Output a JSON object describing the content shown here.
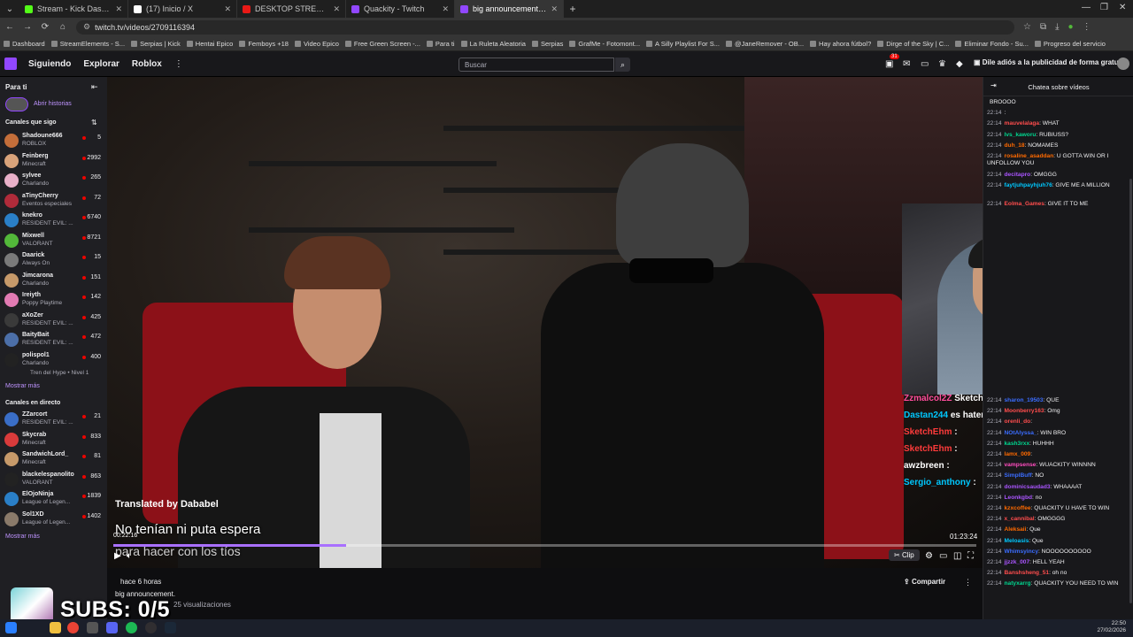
{
  "browser": {
    "tabs": [
      {
        "label": "Stream - Kick Dashboard",
        "color": "#53fc18",
        "active": false
      },
      {
        "label": "(17) Inicio / X",
        "color": "#ffffff",
        "active": false
      },
      {
        "label": "DESKTOP STREAM FT. MR.BEAST",
        "color": "#e91916",
        "active": false
      },
      {
        "label": "Quackity - Twitch",
        "color": "#9147ff",
        "active": false
      },
      {
        "label": "big announcement. - Twitch",
        "color": "#9147ff",
        "active": true
      }
    ],
    "url": "twitch.tv/videos/2709116394",
    "bookmarks": [
      "Dashboard",
      "StreamElements - S...",
      "Serpias | Kick",
      "Hentai Epico",
      "Femboys +18",
      "Video Epico",
      "Free Green Screen -...",
      "Para ti",
      "La Ruleta Aleatoria",
      "Serpias",
      "GrafMe - Fotomont...",
      "A Silly Playlist For S...",
      "@JaneRemover - OB...",
      "Hay ahora fútbol?",
      "Dirge of the Sky | C...",
      "Eliminar Fondo - Su...",
      "Progreso del servicio"
    ]
  },
  "topnav": {
    "links": [
      "Siguiendo",
      "Explorar",
      "Roblox"
    ],
    "search_placeholder": "Buscar",
    "notif_count": "31",
    "ad_label": "Dile adiós a la publicidad de forma gratuita"
  },
  "sidebar": {
    "para_ti": "Para ti",
    "abrir_historias": "Abrir historias",
    "followed_header": "Canales que sigo",
    "followed": [
      {
        "name": "Shadoune666",
        "game": "ROBLOX",
        "count": "5",
        "color": "#c46e3a"
      },
      {
        "name": "Feinberg",
        "game": "Minecraft",
        "count": "2992",
        "color": "#d9a37a"
      },
      {
        "name": "sylvee",
        "game": "Charlando",
        "count": "265",
        "color": "#e9b0c9"
      },
      {
        "name": "aTinyCherry",
        "game": "Eventos especiales",
        "count": "72",
        "color": "#b02b3a"
      },
      {
        "name": "knekro",
        "game": "RESIDENT EVIL: ...",
        "count": "6740",
        "color": "#2a7fc7"
      },
      {
        "name": "Mixwell",
        "game": "VALORANT",
        "count": "8721",
        "color": "#53b83a"
      },
      {
        "name": "Daarick",
        "game": "Always On",
        "count": "15",
        "color": "#7a7a7a"
      },
      {
        "name": "Jimcarona",
        "game": "Charlando",
        "count": "151",
        "color": "#c79a6a"
      },
      {
        "name": "Ireiyth",
        "game": "Poppy Playtime",
        "count": "142",
        "color": "#e27bb3"
      },
      {
        "name": "aXoZer",
        "game": "RESIDENT EVIL: ...",
        "count": "425",
        "color": "#3a3a3a"
      },
      {
        "name": "BaityBait",
        "game": "RESIDENT EVIL: ...",
        "count": "472",
        "color": "#4c6fa8"
      },
      {
        "name": "polispol1",
        "game": "Charlando",
        "count": "400",
        "color": "#222"
      }
    ],
    "hype_train": "Tren del Hype • Nivel 1",
    "more1": "Mostrar más",
    "live_header": "Canales en directo",
    "live": [
      {
        "name": "ZZarcort",
        "game": "RESIDENT EVIL: ...",
        "count": "21",
        "color": "#3a6ec7"
      },
      {
        "name": "Skycrab",
        "game": "Minecraft",
        "count": "833",
        "color": "#d93b3b"
      },
      {
        "name": "SandwichLord_",
        "game": "Minecraft",
        "count": "81",
        "color": "#c79a6a"
      },
      {
        "name": "blackelespanolito",
        "game": "VALORANT",
        "count": "863",
        "color": "#222"
      },
      {
        "name": "ElOjoNinja",
        "game": "League of Legen...",
        "count": "1839",
        "color": "#2a7fc7"
      },
      {
        "name": "Sol1XD",
        "game": "League of Legen...",
        "count": "1402",
        "color": "#8a7a6a"
      }
    ],
    "more2": "Mostrar más"
  },
  "player": {
    "translated_by": "Translated by Dababel",
    "subtitle_line1": "No tenían ni puta espera",
    "subtitle_line2": "para hacer con los tíos",
    "current_time": "00:22:16",
    "total_time": "01:23:24",
    "progress": 0.27,
    "buffered": 0.27,
    "clip_label": "Clip",
    "overlay_chat": [
      {
        "user": "Zzmalcol2Z",
        "msg": "Sketch?",
        "color": "#ff4d9c"
      },
      {
        "user": "Dastan244",
        "msg": "es hater?",
        "color": "#00c8ff"
      },
      {
        "user": "SketchEhm",
        "msg": ":",
        "color": "#ff3b3b"
      },
      {
        "user": "SketchEhm",
        "msg": ":",
        "color": "#ff3b3b"
      },
      {
        "user": "awzbreen",
        "msg": ":",
        "color": "#ffffff"
      },
      {
        "user": "Sergio_anthony",
        "msg": ":",
        "color": "#00c8ff"
      }
    ]
  },
  "video_info": {
    "ago": "hace 6 horas",
    "title": "big announcement.",
    "views": "25 visualizaciones",
    "share": "Compartir"
  },
  "stream_overlay": {
    "subs": "SUBS: 0/5"
  },
  "chat": {
    "title": "Chatea sobre vídeos",
    "messages": [
      {
        "ts": "",
        "user": "",
        "text": "BROOOO",
        "color": "#ffffff"
      },
      {
        "ts": "22:14",
        "user": "",
        "text": ": ",
        "color": "#9147ff"
      },
      {
        "ts": "22:14",
        "user": "mauvelalaga",
        "text": ": WHAT",
        "color": "#ff4d4d"
      },
      {
        "ts": "22:14",
        "user": "lvs_kaworu",
        "text": ": RUBIUSS?",
        "color": "#00d68f"
      },
      {
        "ts": "22:14",
        "user": "duh_18",
        "text": ": NOMAMES",
        "color": "#ff6a00"
      },
      {
        "ts": "22:14",
        "user": "rosaline_asaddan",
        "text": ": U GOTTA WIN OR I UNFOLLOW YOU",
        "color": "#ff6a00"
      },
      {
        "ts": "22:14",
        "user": "decitapro",
        "text": ": OMGGG",
        "color": "#aa55ff"
      },
      {
        "ts": "22:14",
        "user": "faytjuhpayhjuh76",
        "text": ": GIVE ME A MILLION",
        "color": "#00c8ff"
      },
      {
        "ts": "22:14",
        "user": "Eolma_Games",
        "text": ": GIVE IT TO ME",
        "color": "#ff4d4d"
      },
      {
        "ts": "22:14",
        "user": "sharon_19503",
        "text": ": QUE",
        "color": "#3b6dff"
      },
      {
        "ts": "22:14",
        "user": "Moonberry163",
        "text": ": Omg",
        "color": "#ff4d4d"
      },
      {
        "ts": "22:14",
        "user": "orenli_do",
        "text": ":",
        "color": "#ff4d4d"
      },
      {
        "ts": "22:14",
        "user": "NOtAlyssa_",
        "text": ": WIN BRO",
        "color": "#3b6dff"
      },
      {
        "ts": "22:14",
        "user": "kash3rxx",
        "text": ": HUHHH",
        "color": "#00d68f"
      },
      {
        "ts": "22:14",
        "user": "lamx_009",
        "text": ":",
        "color": "#ff6a00"
      },
      {
        "ts": "22:14",
        "user": "vampsense",
        "text": ": WUACKITY WINNNN",
        "color": "#ff4dbf"
      },
      {
        "ts": "22:14",
        "user": "SimplBuff",
        "text": ": NO",
        "color": "#3b6dff"
      },
      {
        "ts": "22:14",
        "user": "dominicsaudad3",
        "text": ": WHAAAAT",
        "color": "#aa55ff"
      },
      {
        "ts": "22:14",
        "user": "Leonkgbd",
        "text": ": no",
        "color": "#aa55ff"
      },
      {
        "ts": "22:14",
        "user": "kzxcoffee",
        "text": ": QUACKITY U HAVE TO WIN",
        "color": "#ff6a00"
      },
      {
        "ts": "22:14",
        "user": "x_cannibal",
        "text": ": OMGGGG",
        "color": "#ff4d4d"
      },
      {
        "ts": "22:14",
        "user": "Aleksaii",
        "text": ": Que",
        "color": "#ff6a00"
      },
      {
        "ts": "22:14",
        "user": "Meloasis",
        "text": ": Que",
        "color": "#00c8ff"
      },
      {
        "ts": "22:14",
        "user": "Whimsyincy",
        "text": ": NOOOOOOOOOO",
        "color": "#3b6dff"
      },
      {
        "ts": "22:14",
        "user": "jjzzk_007",
        "text": ": HELL YEAH",
        "color": "#aa55ff"
      },
      {
        "ts": "22:14",
        "user": "Banshsheng_51",
        "text": ": oh no",
        "color": "#ff4d4d"
      },
      {
        "ts": "22:14",
        "user": "natyxarrg",
        "text": ": QUACKITY YOU NEED TO WIN",
        "color": "#00d68f"
      }
    ]
  },
  "taskbar": {
    "time": "22:50",
    "date": "27/02/2026"
  }
}
